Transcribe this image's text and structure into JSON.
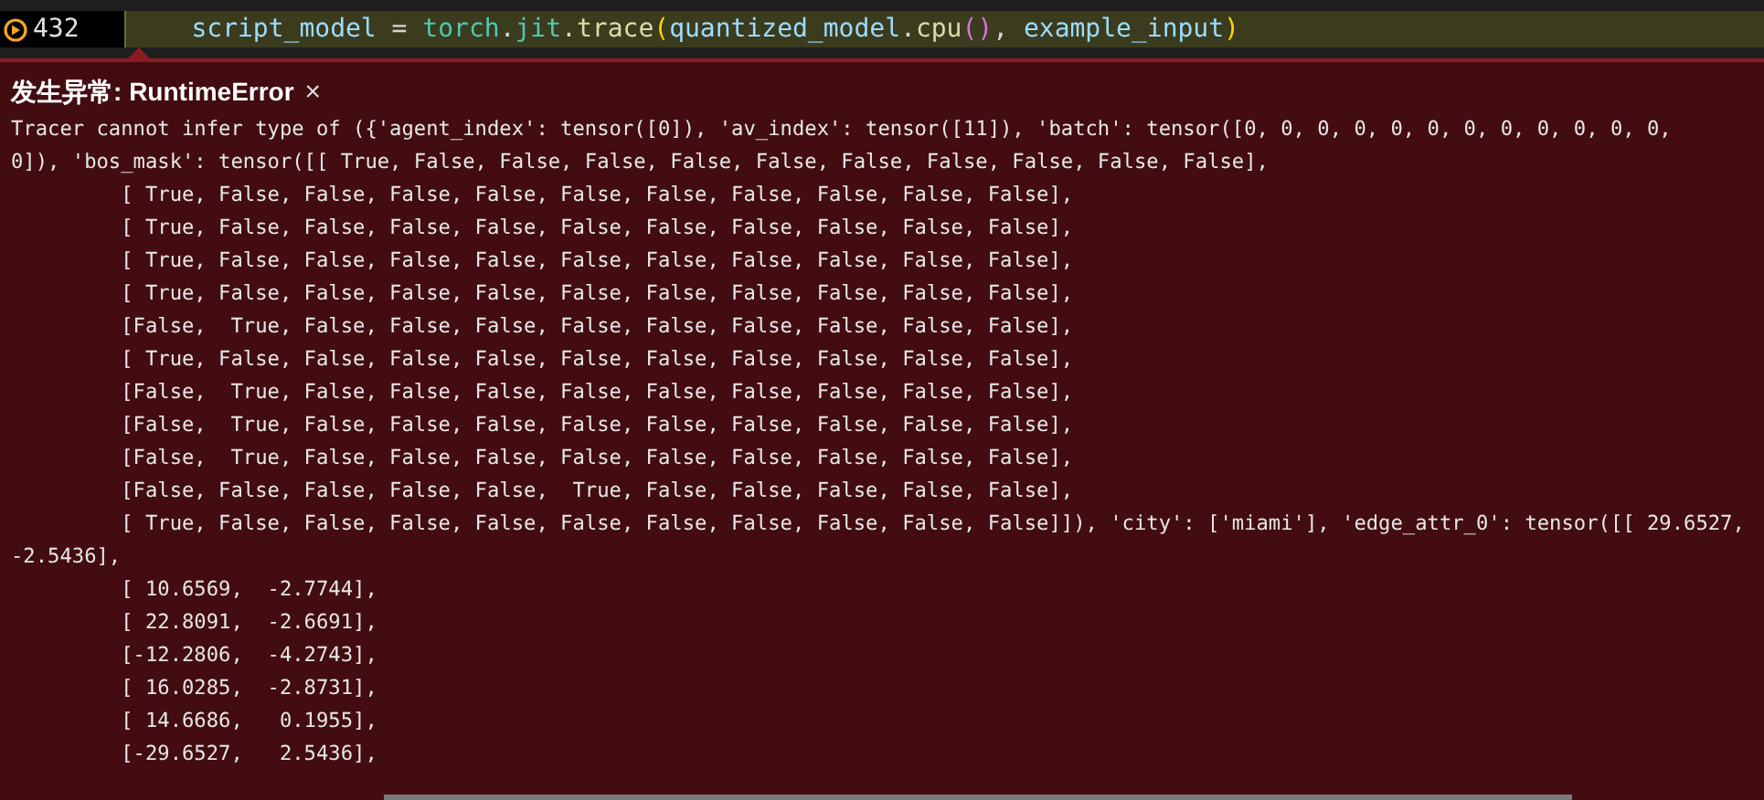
{
  "editor_line": {
    "number": "432",
    "tokens": [
      {
        "text": "    script_model",
        "kind": "variable"
      },
      {
        "text": " = ",
        "kind": "operator"
      },
      {
        "text": "torch",
        "kind": "module"
      },
      {
        "text": ".",
        "kind": "operator"
      },
      {
        "text": "jit",
        "kind": "module"
      },
      {
        "text": ".",
        "kind": "operator"
      },
      {
        "text": "trace",
        "kind": "function"
      },
      {
        "text": "(",
        "kind": "bracket"
      },
      {
        "text": "quantized_model",
        "kind": "variable"
      },
      {
        "text": ".",
        "kind": "operator"
      },
      {
        "text": "cpu",
        "kind": "function"
      },
      {
        "text": "()",
        "kind": "bracket2"
      },
      {
        "text": ", ",
        "kind": "operator"
      },
      {
        "text": "example_input",
        "kind": "variable"
      },
      {
        "text": ")",
        "kind": "bracket"
      }
    ]
  },
  "exception": {
    "label": "发生异常:",
    "type": "RuntimeError",
    "close": "×",
    "lines": [
      "Tracer cannot infer type of ({'agent_index': tensor([0]), 'av_index': tensor([11]), 'batch': tensor([0, 0, 0, 0, 0, 0, 0, 0, 0, 0, 0, 0,",
      "0]), 'bos_mask': tensor([[ True, False, False, False, False, False, False, False, False, False, False],",
      "         [ True, False, False, False, False, False, False, False, False, False, False],",
      "         [ True, False, False, False, False, False, False, False, False, False, False],",
      "         [ True, False, False, False, False, False, False, False, False, False, False],",
      "         [ True, False, False, False, False, False, False, False, False, False, False],",
      "         [False,  True, False, False, False, False, False, False, False, False, False],",
      "         [ True, False, False, False, False, False, False, False, False, False, False],",
      "         [False,  True, False, False, False, False, False, False, False, False, False],",
      "         [False,  True, False, False, False, False, False, False, False, False, False],",
      "         [False,  True, False, False, False, False, False, False, False, False, False],",
      "         [False, False, False, False, False,  True, False, False, False, False, False],",
      "         [ True, False, False, False, False, False, False, False, False, False, False]]), 'city': ['miami'], 'edge_attr_0': tensor([[ 29.6527,",
      "-2.5436],",
      "         [ 10.6569,  -2.7744],",
      "         [ 22.8091,  -2.6691],",
      "         [-12.2806,  -4.2743],",
      "         [ 16.0285,  -2.8731],",
      "         [ 14.6686,   0.1955],",
      "         [-29.6527,   2.5436],"
    ]
  }
}
